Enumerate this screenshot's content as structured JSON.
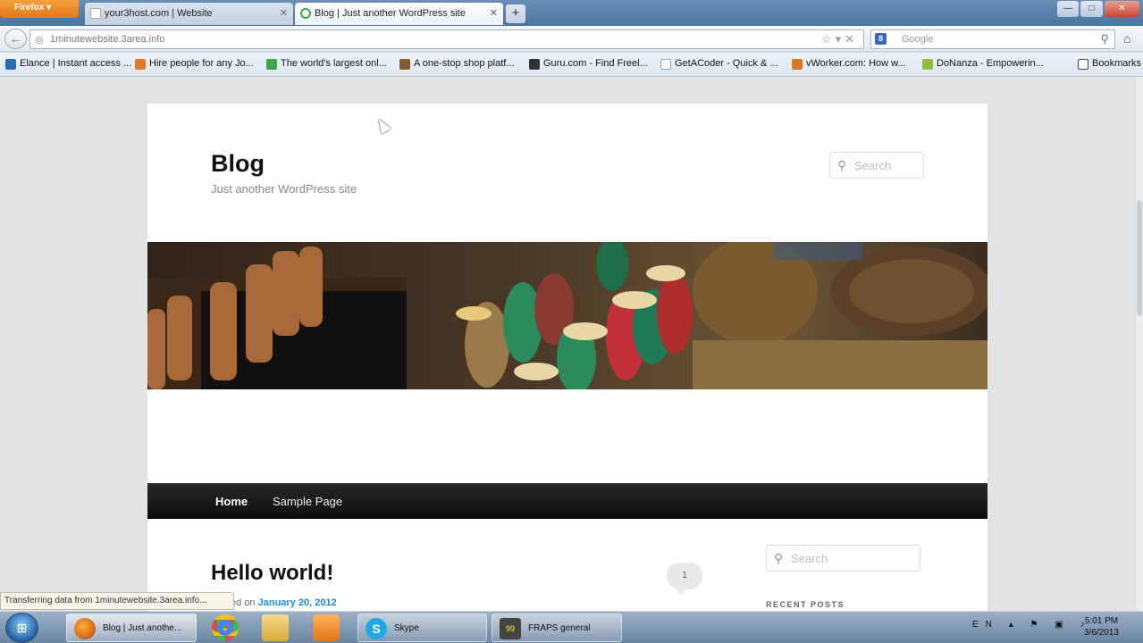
{
  "browser": {
    "menu_button": "Firefox",
    "tabs": [
      {
        "label": "your3host.com | Website"
      },
      {
        "label": "Blog | Just another WordPress site"
      }
    ],
    "new_tab_label": "+",
    "url": "1minutewebsite.3area.info",
    "search_placeholder": "Google",
    "bookmarks": [
      {
        "label": "Elance | Instant access ...",
        "color": "#2b6cb0"
      },
      {
        "label": "Hire people for any Jo...",
        "color": "#e07a1f"
      },
      {
        "label": "The world's largest onl...",
        "color": "#3ca64a"
      },
      {
        "label": "A one-stop shop platf...",
        "color": "#8a5a2b"
      },
      {
        "label": "Guru.com - Find Freel...",
        "color": "#333333"
      },
      {
        "label": "GetACoder - Quick & ...",
        "color": "#9aa4b0"
      },
      {
        "label": "vWorker.com: How w...",
        "color": "#d8781c"
      },
      {
        "label": "DoNanza - Empowerin...",
        "color": "#8bbf3a"
      },
      {
        "label": "Bookmarks",
        "color": "#444444"
      }
    ],
    "status_text": "Transferring data from 1minutewebsite.3area.info..."
  },
  "site": {
    "title": "Blog",
    "description": "Just another WordPress site",
    "search_placeholder": "Search",
    "nav": [
      "Home",
      "Sample Page"
    ],
    "post": {
      "title": "Hello world!",
      "posted_prefix": "Posted on",
      "posted_date": "January 20, 2012",
      "comment_count": "1"
    },
    "sidebar_search_placeholder": "Search",
    "recent_posts_heading": "RECENT POSTS"
  },
  "taskbar": {
    "windows": [
      {
        "label": "Blog | Just anothe...",
        "icon": "firefox-icon",
        "color": "#e06a16"
      },
      {
        "label": "Skype",
        "icon": "skype-icon",
        "color": "#1fa8e6"
      },
      {
        "label": "FRAPS general",
        "icon": "fraps-icon",
        "color": "#444444"
      }
    ],
    "pinned": [
      {
        "icon": "chrome-icon",
        "color": "#dd4b39"
      },
      {
        "icon": "folder-icon",
        "color": "#e9c46a"
      },
      {
        "icon": "media-player-icon",
        "color": "#f08a24"
      }
    ],
    "language": "EN",
    "time": "5:01 PM",
    "date": "3/6/2013"
  },
  "colors": {
    "link": "#1b8be0",
    "nav_background": "#111111",
    "firefox_orange": "#e2761a"
  }
}
